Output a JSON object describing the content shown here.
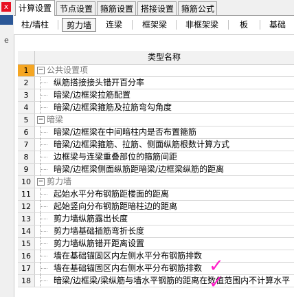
{
  "tabs": [
    "计算设置",
    "节点设置",
    "箍筋设置",
    "搭接设置",
    "箍筋公式"
  ],
  "subtabs": [
    "柱/墙柱",
    "剪力墙",
    "连梁",
    "框架梁",
    "非框架梁",
    "板",
    "基础"
  ],
  "left_strip": {
    "close": "x",
    "label": "e"
  },
  "table": {
    "header": "类型名称",
    "rows": [
      {
        "num": "1",
        "text": "公共设置项",
        "group": true,
        "selected": true
      },
      {
        "num": "2",
        "text": "纵筋搭接接头错开百分率"
      },
      {
        "num": "3",
        "text": "暗梁/边框梁拉筋配置"
      },
      {
        "num": "4",
        "text": "暗梁/边框梁箍筋及拉筋弯勾角度"
      },
      {
        "num": "5",
        "text": "暗梁",
        "group": true
      },
      {
        "num": "6",
        "text": "暗梁/边框梁在中间暗柱内是否布置箍筋"
      },
      {
        "num": "7",
        "text": "暗梁/边框梁箍筋、拉筋、侧面纵筋根数计算方式"
      },
      {
        "num": "8",
        "text": "边框梁与连梁重叠部位的箍筋间距"
      },
      {
        "num": "9",
        "text": "暗梁/边框梁侧面纵筋距暗梁/边框梁纵筋的距离"
      },
      {
        "num": "10",
        "text": "剪力墙",
        "group": true
      },
      {
        "num": "11",
        "text": "起始水平分布钢筋距楼面的距离"
      },
      {
        "num": "12",
        "text": "起始竖向分布钢筋距暗柱边的距离"
      },
      {
        "num": "13",
        "text": "剪力墙纵筋露出长度"
      },
      {
        "num": "14",
        "text": "剪力墙基础插筋弯折长度"
      },
      {
        "num": "15",
        "text": "剪力墙纵筋错开距离设置"
      },
      {
        "num": "16",
        "text": "墙在基础锚固区内左侧水平分布钢筋排数"
      },
      {
        "num": "17",
        "text": "墙在基础锚固区内右侧水平分布钢筋排数"
      },
      {
        "num": "18",
        "text": "暗梁/边框梁/梁纵筋与墙水平钢筋的距离在数值范围内不计算水平"
      }
    ]
  },
  "annotations": {
    "check_16": "✓",
    "check_17": "✓"
  }
}
